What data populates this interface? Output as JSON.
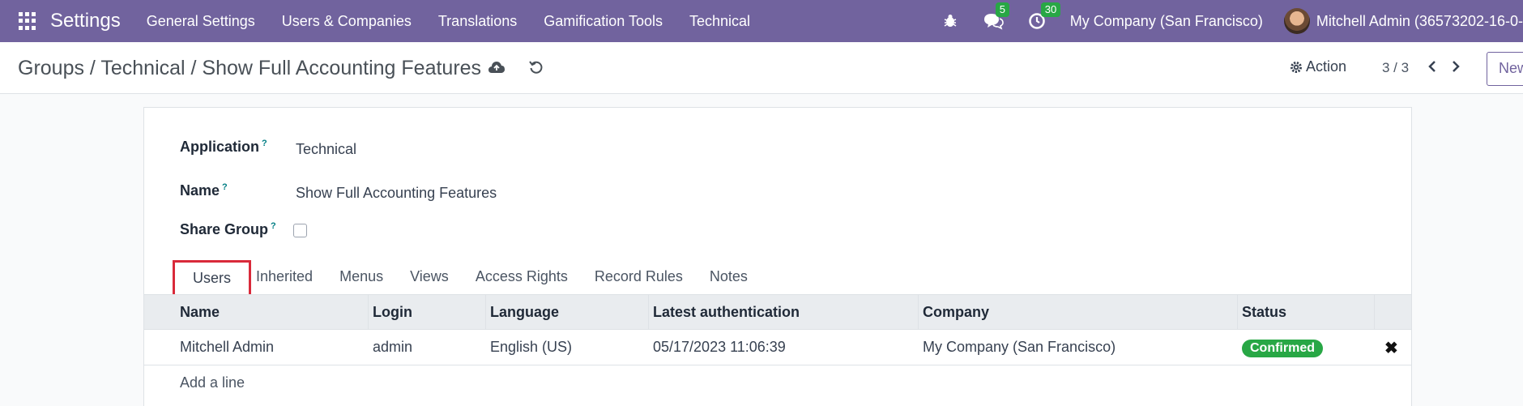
{
  "navbar": {
    "brand": "Settings",
    "menu": [
      "General Settings",
      "Users & Companies",
      "Translations",
      "Gamification Tools",
      "Technical"
    ],
    "messages_count": "5",
    "activities_count": "30",
    "company": "My Company (San Francisco)",
    "user": "Mitchell Admin (36573202-16-0-"
  },
  "control": {
    "breadcrumb": "Groups / Technical / Show Full Accounting Features",
    "action_label": "Action",
    "pager": "3 / 3",
    "new_label": "New"
  },
  "form": {
    "application_label": "Application",
    "application_value": "Technical",
    "name_label": "Name",
    "name_value": "Show Full Accounting Features",
    "share_label": "Share Group",
    "help_mark": "?"
  },
  "tabs": [
    "Users",
    "Inherited",
    "Menus",
    "Views",
    "Access Rights",
    "Record Rules",
    "Notes"
  ],
  "table": {
    "headers": [
      "Name",
      "Login",
      "Language",
      "Latest authentication",
      "Company",
      "Status"
    ],
    "rows": [
      [
        "Mitchell Admin",
        "admin",
        "English (US)",
        "05/17/2023 11:06:39",
        "My Company (San Francisco)",
        "Confirmed"
      ]
    ],
    "add_line": "Add a line"
  },
  "colors": {
    "brand": "#71639e",
    "badge": "#28a745",
    "highlight": "#d92a3a"
  }
}
